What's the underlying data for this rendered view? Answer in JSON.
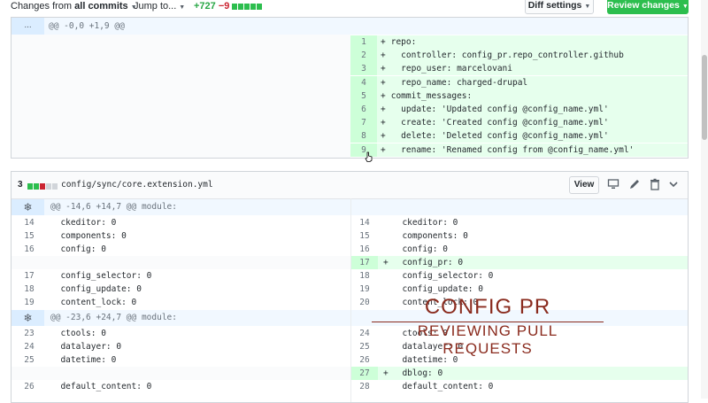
{
  "toolbar": {
    "changes_prefix": "Changes from ",
    "changes_value": "all commits",
    "jump_label": "Jump to...",
    "additions": "+727",
    "deletions": "−9",
    "diff_settings": "Diff settings",
    "review_changes": "Review changes"
  },
  "file1": {
    "expander": "...",
    "hunk": "@@ -0,0 +1,9 @@",
    "lines": [
      {
        "num": "1",
        "sign": "+",
        "code": " repo:"
      },
      {
        "num": "2",
        "sign": "+",
        "code": "   controller: config_pr.repo_controller.github"
      },
      {
        "num": "3",
        "sign": "+",
        "code": "   repo_user: marcelovani"
      },
      {
        "num": "4",
        "sign": "+",
        "code": "   repo_name: charged-drupal"
      },
      {
        "num": "5",
        "sign": "+",
        "code": " commit_messages:"
      },
      {
        "num": "6",
        "sign": "+",
        "code": "   update: 'Updated config @config_name.yml'"
      },
      {
        "num": "7",
        "sign": "+",
        "code": "   create: 'Created config @config_name.yml'"
      },
      {
        "num": "8",
        "sign": "+",
        "code": "   delete: 'Deleted config @config_name.yml'"
      },
      {
        "num": "9",
        "sign": "+",
        "code": "   rename: 'Renamed config from @config_name.yml'"
      }
    ]
  },
  "file2": {
    "count": "3",
    "path": "config/sync/core.extension.yml",
    "view_label": "View",
    "hunk1": "@@ -14,6 +14,7 @@ module:",
    "hunk2": "@@ -23,6 +24,7 @@ module:",
    "rows1": [
      {
        "ln": "14",
        "lc": "  ckeditor: 0",
        "rn": "14",
        "rs": "",
        "rc": "  ckeditor: 0"
      },
      {
        "ln": "15",
        "lc": "  components: 0",
        "rn": "15",
        "rs": "",
        "rc": "  components: 0"
      },
      {
        "ln": "16",
        "lc": "  config: 0",
        "rn": "16",
        "rs": "",
        "rc": "  config: 0"
      },
      {
        "ln": "",
        "lc": "",
        "rn": "17",
        "rs": "+",
        "rc": "  config_pr: 0"
      },
      {
        "ln": "17",
        "lc": "  config_selector: 0",
        "rn": "18",
        "rs": "",
        "rc": "  config_selector: 0"
      },
      {
        "ln": "18",
        "lc": "  config_update: 0",
        "rn": "19",
        "rs": "",
        "rc": "  config_update: 0"
      },
      {
        "ln": "19",
        "lc": "  content_lock: 0",
        "rn": "20",
        "rs": "",
        "rc": "  content_lock: 0"
      }
    ],
    "rows2": [
      {
        "ln": "23",
        "lc": "  ctools: 0",
        "rn": "24",
        "rs": "",
        "rc": "  ctools: 0"
      },
      {
        "ln": "24",
        "lc": "  datalayer: 0",
        "rn": "25",
        "rs": "",
        "rc": "  datalayer: 0"
      },
      {
        "ln": "25",
        "lc": "  datetime: 0",
        "rn": "26",
        "rs": "",
        "rc": "  datetime: 0"
      },
      {
        "ln": "",
        "lc": "",
        "rn": "27",
        "rs": "+",
        "rc": "  dblog: 0"
      },
      {
        "ln": "26",
        "lc": "  default_content: 0",
        "rn": "28",
        "rs": "",
        "rc": "  default_content: 0"
      }
    ]
  },
  "overlay": {
    "title": "CONFIG PR",
    "subtitle": "REVIEWING PULL REQUESTS"
  },
  "colors": {
    "add_bg": "#e6ffed",
    "add_num_bg": "#cdffd8",
    "hunk_bg": "#f1f8ff",
    "accent_green": "#2cbe4e",
    "overlay": "#8a2b1e"
  }
}
